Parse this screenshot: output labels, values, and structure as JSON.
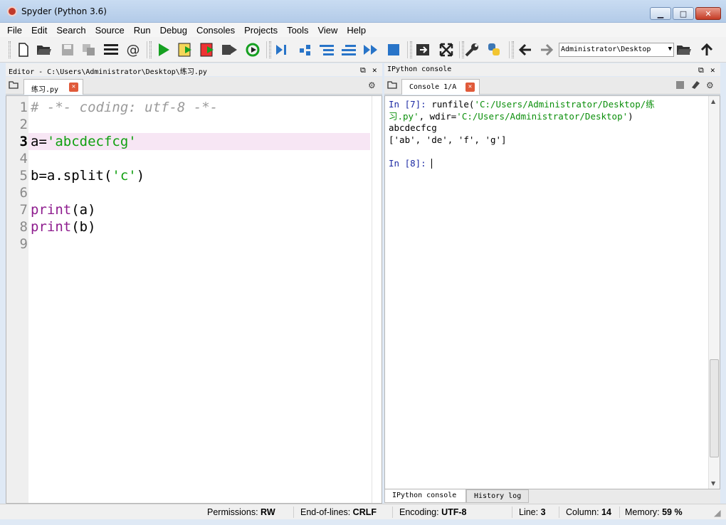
{
  "window": {
    "title": "Spyder (Python 3.6)",
    "min_glyph": "▁",
    "max_glyph": "□",
    "close_glyph": "✕"
  },
  "menu": [
    "File",
    "Edit",
    "Search",
    "Source",
    "Run",
    "Debug",
    "Consoles",
    "Projects",
    "Tools",
    "View",
    "Help"
  ],
  "toolbar": {
    "working_dir": "Administrator\\Desktop",
    "icons": [
      "new-file-icon",
      "open-file-icon",
      "save-icon",
      "save-all-icon",
      "outline-icon",
      "at-icon",
      "run-icon",
      "run-cell-icon",
      "run-cell-advance-icon",
      "run-selection-icon",
      "rerun-icon",
      "debug-icon",
      "step-icon",
      "step-into-icon",
      "step-return-icon",
      "continue-icon",
      "stop-debug-icon",
      "maximize-pane-icon",
      "fullscreen-icon",
      "preferences-icon",
      "python-path-icon",
      "back-icon",
      "forward-icon",
      "browse-folder-icon",
      "parent-dir-icon"
    ]
  },
  "editor": {
    "pane_title": "Editor - C:\\Users\\Administrator\\Desktop\\练习.py",
    "tab_label": "练习.py",
    "current_line": 3,
    "line_numbers": [
      "1",
      "2",
      "3",
      "4",
      "5",
      "6",
      "7",
      "8",
      "9"
    ],
    "lines": [
      {
        "parts": [
          {
            "t": "# -*- coding: utf-8 -*-",
            "c": "c-comment"
          }
        ]
      },
      {
        "parts": []
      },
      {
        "parts": [
          {
            "t": "a=",
            "c": ""
          },
          {
            "t": "'abcdecfcg'",
            "c": "c-str"
          }
        ]
      },
      {
        "parts": []
      },
      {
        "parts": [
          {
            "t": "b=a.split(",
            "c": ""
          },
          {
            "t": "'c'",
            "c": "c-str"
          },
          {
            "t": ")",
            "c": ""
          }
        ]
      },
      {
        "parts": []
      },
      {
        "parts": [
          {
            "t": "print",
            "c": "c-kw"
          },
          {
            "t": "(a)",
            "c": ""
          }
        ]
      },
      {
        "parts": [
          {
            "t": "print",
            "c": "c-kw"
          },
          {
            "t": "(b)",
            "c": ""
          }
        ]
      },
      {
        "parts": []
      }
    ]
  },
  "console": {
    "pane_title": "IPython console",
    "tab_label": "Console 1/A",
    "lines": [
      {
        "parts": [
          {
            "t": "In [",
            "c": "c-in"
          },
          {
            "t": "7",
            "c": "c-in"
          },
          {
            "t": "]: ",
            "c": "c-in"
          },
          {
            "t": "runfile(",
            "c": ""
          },
          {
            "t": "'C:/Users/Administrator/Desktop/练",
            "c": "c-green"
          }
        ]
      },
      {
        "parts": [
          {
            "t": "习.py'",
            "c": "c-green"
          },
          {
            "t": ", wdir=",
            "c": ""
          },
          {
            "t": "'C:/Users/Administrator/Desktop'",
            "c": "c-green"
          },
          {
            "t": ")",
            "c": ""
          }
        ]
      },
      {
        "parts": [
          {
            "t": "abcdecfcg",
            "c": ""
          }
        ]
      },
      {
        "parts": [
          {
            "t": "['ab', 'de', 'f', 'g']",
            "c": ""
          }
        ]
      },
      {
        "parts": []
      },
      {
        "parts": [
          {
            "t": "In [",
            "c": "c-in"
          },
          {
            "t": "8",
            "c": "c-in"
          },
          {
            "t": "]: ",
            "c": "c-in"
          }
        ]
      }
    ],
    "bottom_tabs": [
      "IPython console",
      "History log"
    ]
  },
  "status": {
    "permissions_label": "Permissions:",
    "permissions": "RW",
    "eol_label": "End-of-lines:",
    "eol": "CRLF",
    "encoding_label": "Encoding:",
    "encoding": "UTF-8",
    "line_label": "Line:",
    "line": "3",
    "column_label": "Column:",
    "column": "14",
    "memory_label": "Memory:",
    "memory": "59 %"
  }
}
